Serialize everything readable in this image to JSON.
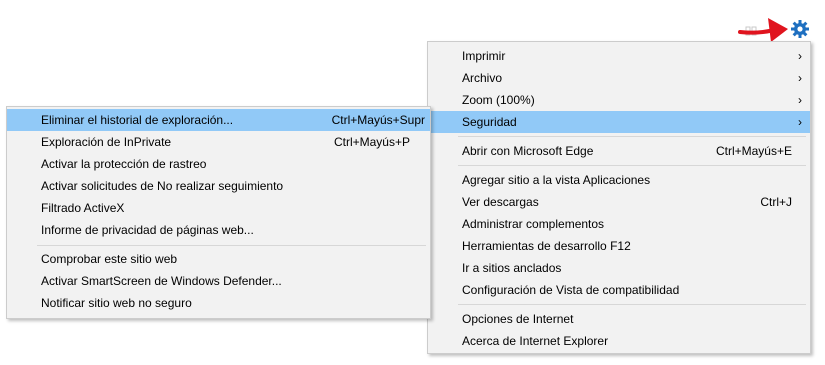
{
  "main_menu": {
    "items": [
      {
        "label": "Imprimir",
        "shortcut": "",
        "submenu": true
      },
      {
        "label": "Archivo",
        "shortcut": "",
        "submenu": true
      },
      {
        "label": "Zoom (100%)",
        "shortcut": "",
        "submenu": true
      },
      {
        "label": "Seguridad",
        "shortcut": "",
        "submenu": true,
        "highlighted": true
      },
      {
        "label": "Abrir con Microsoft Edge",
        "shortcut": "Ctrl+Mayús+E"
      },
      {
        "label": "Agregar sitio a la vista Aplicaciones",
        "shortcut": ""
      },
      {
        "label": "Ver descargas",
        "shortcut": "Ctrl+J"
      },
      {
        "label": "Administrar complementos",
        "shortcut": ""
      },
      {
        "label": "Herramientas de desarrollo F12",
        "shortcut": ""
      },
      {
        "label": "Ir a sitios anclados",
        "shortcut": ""
      },
      {
        "label": "Configuración de Vista de compatibilidad",
        "shortcut": ""
      },
      {
        "label": "Opciones de Internet",
        "shortcut": ""
      },
      {
        "label": "Acerca de Internet Explorer",
        "shortcut": ""
      }
    ],
    "submenu_arrow": "›"
  },
  "security_submenu": {
    "items": [
      {
        "label": "Eliminar el historial de exploración...",
        "shortcut": "Ctrl+Mayús+Supr",
        "highlighted": true
      },
      {
        "label": "Exploración de InPrivate",
        "shortcut": "Ctrl+Mayús+P"
      },
      {
        "label": "Activar la protección de rastreo",
        "shortcut": ""
      },
      {
        "label": "Activar solicitudes de No realizar seguimiento",
        "shortcut": ""
      },
      {
        "label": "Filtrado ActiveX",
        "shortcut": ""
      },
      {
        "label": "Informe de privacidad de páginas web...",
        "shortcut": ""
      },
      {
        "label": "Comprobar este sitio web",
        "shortcut": ""
      },
      {
        "label": "Activar SmartScreen de Windows Defender...",
        "shortcut": ""
      },
      {
        "label": "Notificar sitio web no seguro",
        "shortcut": ""
      }
    ]
  },
  "toolbar": {
    "icons": [
      "tools-gear-icon",
      "favorites-icon"
    ]
  },
  "annotation": {
    "icon": "red-arrow-pointer"
  },
  "colors": {
    "highlight": "#91c9f7",
    "menu_bg": "#f2f2f2",
    "gear": "#1e6fc0",
    "arrow": "#e0141e"
  }
}
